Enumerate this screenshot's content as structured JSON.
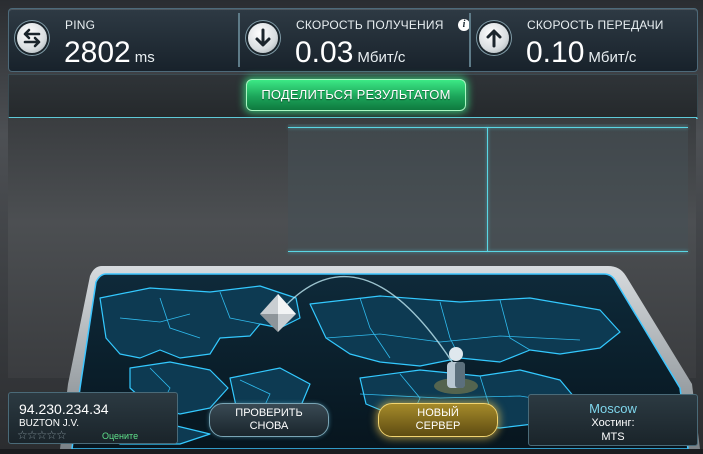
{
  "metrics": {
    "ping": {
      "label": "PING",
      "value": "2802",
      "unit": "ms"
    },
    "download": {
      "label": "СКОРОСТЬ ПОЛУЧЕНИЯ",
      "value": "0.03",
      "unit": "Мбит/с"
    },
    "upload": {
      "label": "СКОРОСТЬ ПЕРЕДАЧИ",
      "value": "0.10",
      "unit": "Мбит/с"
    }
  },
  "share": {
    "label": "ПОДЕЛИТЬСЯ РЕЗУЛЬТАТОМ"
  },
  "client": {
    "ip": "94.230.234.34",
    "isp": "BUZTON J.V.",
    "rate_label": "Оцените",
    "stars_total": 5,
    "stars_filled": 0
  },
  "buttons": {
    "test_again_line1": "ПРОВЕРИТЬ",
    "test_again_line2": "СНОВА",
    "new_server_line1": "НОВЫЙ",
    "new_server_line2": "СЕРВЕР"
  },
  "server": {
    "city": "Moscow",
    "hosting_label": "Хостинг:",
    "hosting_value": "MTS"
  },
  "colors": {
    "accent_cyan": "#5ad6e4",
    "share_green": "#1ca55a",
    "server_gold": "#c9a63a",
    "rate_green": "#5fe08a"
  },
  "icons": {
    "ping": "swap-arrows-icon",
    "download": "download-arrow-icon",
    "upload": "upload-arrow-icon",
    "info": "info-icon",
    "client_marker": "diamond-marker-icon",
    "server_marker": "person-pin-icon"
  }
}
